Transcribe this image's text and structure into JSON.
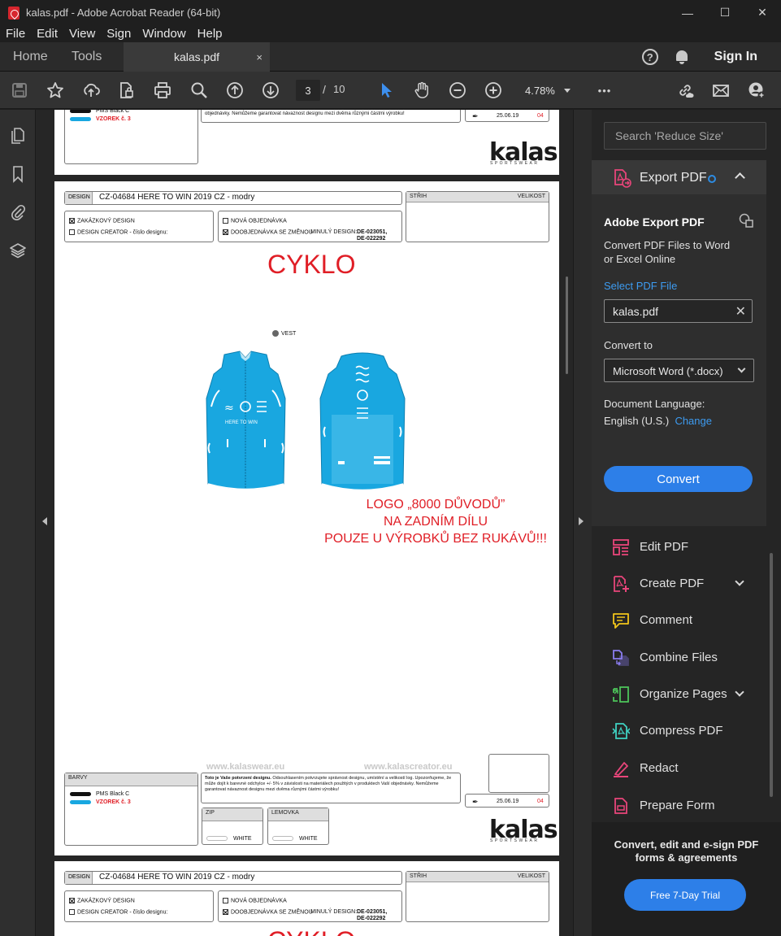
{
  "window": {
    "title": "kalas.pdf - Adobe Acrobat Reader (64-bit)",
    "minimize": "—",
    "maximize": "☐",
    "close": "✕"
  },
  "menu": [
    "File",
    "Edit",
    "View",
    "Sign",
    "Window",
    "Help"
  ],
  "tabs": {
    "home": "Home",
    "tools": "Tools",
    "file": "kalas.pdf",
    "file_close": "×",
    "help": "?",
    "signin": "Sign In"
  },
  "toolbar": {
    "page_current": "3",
    "page_sep": "/",
    "page_total": "10",
    "zoom": "4.78%",
    "more": "•••"
  },
  "doc": {
    "pms_black": "PMS Black C",
    "vzorek": "VZOREK č. 3",
    "date": "25.06.19",
    "page_num": "04",
    "notice_tail": "objednávky.  Nemůžeme garantovat návaznost designu mezi dvěma různými částmi výrobku!",
    "design_label": "DESIGN",
    "design_name": "CZ-04684 HERE TO WIN 2019 CZ - modry",
    "strih": "STŘIH",
    "velikost": "VELIKOST",
    "zakaznicky": "ZAKÁZKOVÝ DESIGN",
    "creator": "DESIGN CREATOR",
    "cislo": "- číslo designu:",
    "nova_obj": "NOVÁ OBJEDNÁVKA",
    "doobj": "DOOBJEDNÁVKA SE ZMĚNOU",
    "minuly": "MINULÝ DESIGN:",
    "minuly_val1": "DE-023051,",
    "minuly_val2": "DE-022292",
    "cyklo": "CYKLO",
    "vest": "VEST",
    "logo_line1": "LOGO „8000 DŮVODŮ”",
    "logo_line2": "NA ZADNÍM DÍLU",
    "logo_line3": "POUZE U VÝROBKŮ BEZ RUKÁVŮ!!!",
    "jersey_text": "HERE TO WIN",
    "web1": "www.kalaswear.eu",
    "web2": "www.kalascreator.eu",
    "barvy": "BARVY",
    "notice_bold": "Toto je Vaše potvrzení designu.",
    "notice_rest": " Odsouhlasením potvrzujete správnost designu, umístění a velikostí log. Upozorňujeme, že může dojít k barevné odchylce +/- 5% v závislosti na materiálech použitých v produktech Vaší objednávky.  Nemůžeme garantovat návaznost designu mezi dvěma různými částmi výrobku!",
    "zip": "ZIP",
    "lemovka": "LEMOVKA",
    "white": "WHITE",
    "kalas": "kalas",
    "sportswear": "SPORTSWEAR"
  },
  "rpane": {
    "search_placeholder": "Search 'Reduce Size'",
    "export_label": "Export PDF",
    "ep_title": "Adobe Export PDF",
    "ep_desc": "Convert PDF Files to Word or Excel Online",
    "select_label": "Select PDF File",
    "file": "kalas.pdf",
    "file_clear": "✕",
    "convert_to": "Convert to",
    "format": "Microsoft Word (*.docx)",
    "doc_lang_label": "Document Language:",
    "doc_lang": "English (U.S.)",
    "change": "Change",
    "convert": "Convert",
    "tools": [
      {
        "label": "Edit PDF",
        "icon": "edit-pdf-icon",
        "color": "#e8457a"
      },
      {
        "label": "Create PDF",
        "icon": "create-pdf-icon",
        "color": "#e8457a"
      },
      {
        "label": "Comment",
        "icon": "comment-icon",
        "color": "#f2c51a"
      },
      {
        "label": "Combine Files",
        "icon": "combine-files-icon",
        "color": "#8b7df0"
      },
      {
        "label": "Organize Pages",
        "icon": "organize-pages-icon",
        "color": "#4cc35a"
      },
      {
        "label": "Compress PDF",
        "icon": "compress-pdf-icon",
        "color": "#e8457a"
      },
      {
        "label": "Redact",
        "icon": "redact-icon",
        "color": "#e8457a"
      },
      {
        "label": "Prepare Form",
        "icon": "prepare-form-icon",
        "color": "#e8457a"
      }
    ],
    "promo_text": "Convert, edit and e-sign PDF forms & agreements",
    "trial": "Free 7-Day Trial"
  },
  "colors": {
    "accent_blue": "#2d7fe8",
    "link_blue": "#3d9bf0",
    "jersey_cyan": "#19a7e0",
    "cyklo_red": "#e01e26"
  }
}
